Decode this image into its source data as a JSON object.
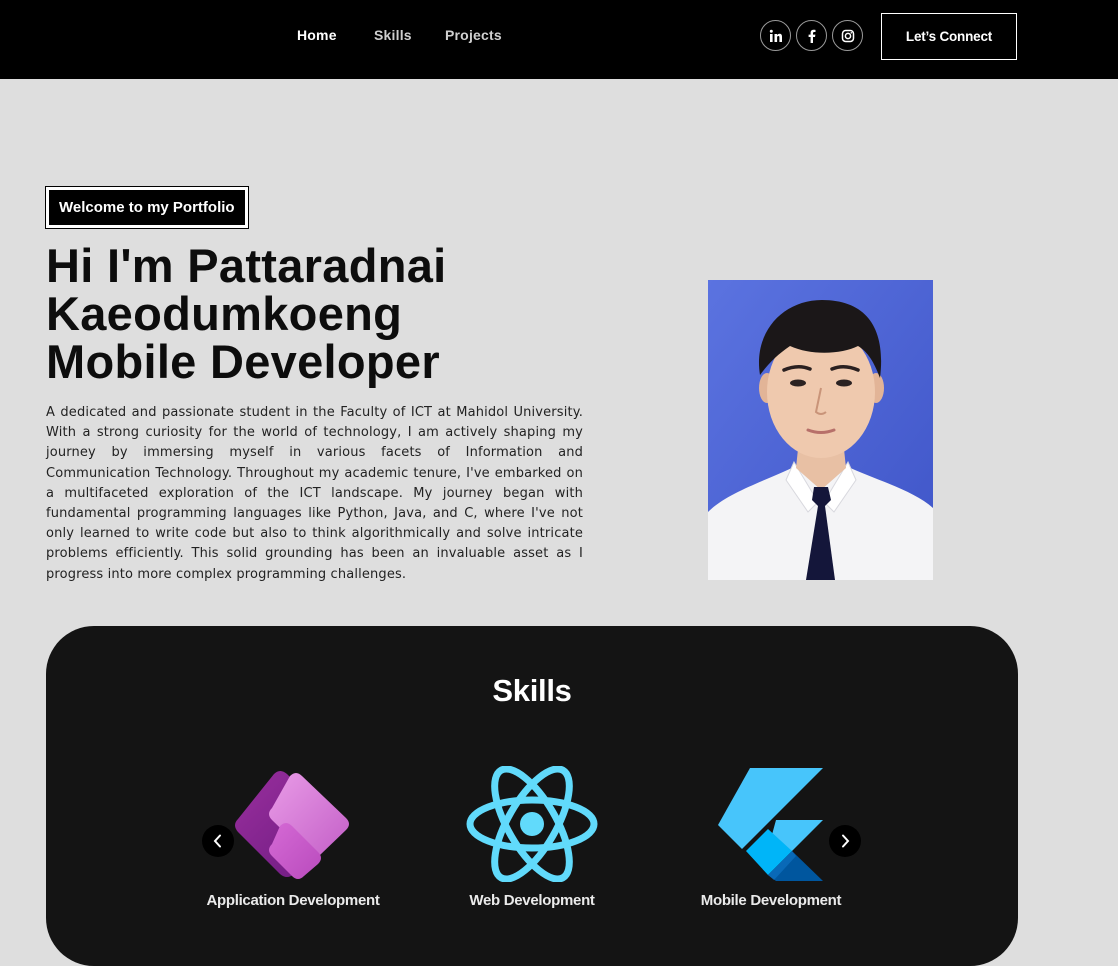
{
  "nav": {
    "links": [
      {
        "label": "Home",
        "active": true
      },
      {
        "label": "Skills",
        "active": false
      },
      {
        "label": "Projects",
        "active": false
      }
    ],
    "social_icons": [
      "linkedin-icon",
      "facebook-icon",
      "instagram-icon"
    ],
    "connect_label": "Let’s Connect"
  },
  "hero": {
    "tagline": "Welcome to my Portfolio",
    "title_lines": [
      "Hi I'm Pattaradnai",
      "Kaeodumkoeng",
      "Mobile Developer"
    ],
    "description": "A dedicated and passionate student in the Faculty of ICT at Mahidol University. With a strong curiosity for the world of technology, I am actively shaping my journey by immersing myself in various facets of Information and Communication Technology. Throughout my academic tenure, I've embarked on a multifaceted exploration of the ICT landscape. My journey began with fundamental programming languages like Python, Java, and C, where I've not only learned to write code but also to think algorithmically and solve intricate problems efficiently. This solid grounding has been an invaluable asset as I progress into more complex programming challenges."
  },
  "skills": {
    "title": "Skills",
    "items": [
      {
        "label": "Application Development",
        "icon": "power-apps-icon"
      },
      {
        "label": "Web Development",
        "icon": "react-icon"
      },
      {
        "label": "Mobile Development",
        "icon": "flutter-icon"
      }
    ]
  },
  "colors": {
    "nav_bg": "#000000",
    "page_bg": "#dedede",
    "panel_bg": "#141414",
    "react_cyan": "#61dafb",
    "flutter_light": "#47c5fb",
    "flutter_dark": "#00569e",
    "power_apps_purple": "#b03fb0"
  }
}
